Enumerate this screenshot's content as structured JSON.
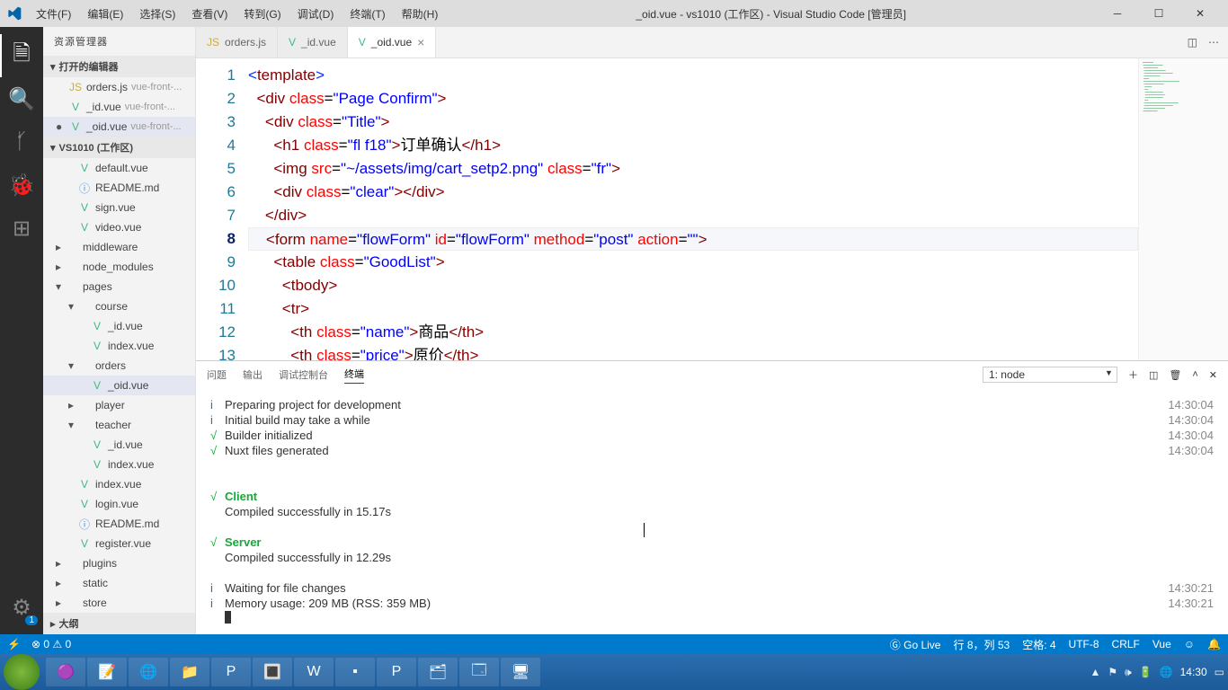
{
  "titlebar": {
    "app_title": "_oid.vue - vs1010 (工作区) - Visual Studio Code [管理员]",
    "menus": [
      "文件(F)",
      "编辑(E)",
      "选择(S)",
      "查看(V)",
      "转到(G)",
      "调试(D)",
      "终端(T)",
      "帮助(H)"
    ]
  },
  "sidebar": {
    "header": "资源管理器",
    "open_editors_label": "打开的编辑器",
    "open_editors": [
      {
        "name": "orders.js",
        "hint": "vue-front-...",
        "kind": "js"
      },
      {
        "name": "_id.vue",
        "hint": "vue-front-...",
        "kind": "vue"
      },
      {
        "name": "_oid.vue",
        "hint": "vue-front-...",
        "kind": "vue",
        "active": true
      }
    ],
    "workspace_label": "VS1010 (工作区)",
    "tree": [
      {
        "d": 1,
        "t": "",
        "name": "default.vue",
        "kind": "vue"
      },
      {
        "d": 1,
        "t": "",
        "name": "README.md",
        "kind": "info"
      },
      {
        "d": 1,
        "t": "",
        "name": "sign.vue",
        "kind": "vue"
      },
      {
        "d": 1,
        "t": "",
        "name": "video.vue",
        "kind": "vue"
      },
      {
        "d": 0,
        "t": "▸",
        "name": "middleware",
        "kind": "folder"
      },
      {
        "d": 0,
        "t": "▸",
        "name": "node_modules",
        "kind": "folder"
      },
      {
        "d": 0,
        "t": "▾",
        "name": "pages",
        "kind": "folder"
      },
      {
        "d": 1,
        "t": "▾",
        "name": "course",
        "kind": "folder"
      },
      {
        "d": 2,
        "t": "",
        "name": "_id.vue",
        "kind": "vue"
      },
      {
        "d": 2,
        "t": "",
        "name": "index.vue",
        "kind": "vue"
      },
      {
        "d": 1,
        "t": "▾",
        "name": "orders",
        "kind": "folder"
      },
      {
        "d": 2,
        "t": "",
        "name": "_oid.vue",
        "kind": "vue",
        "sel": true
      },
      {
        "d": 1,
        "t": "▸",
        "name": "player",
        "kind": "folder"
      },
      {
        "d": 1,
        "t": "▾",
        "name": "teacher",
        "kind": "folder"
      },
      {
        "d": 2,
        "t": "",
        "name": "_id.vue",
        "kind": "vue"
      },
      {
        "d": 2,
        "t": "",
        "name": "index.vue",
        "kind": "vue"
      },
      {
        "d": 1,
        "t": "",
        "name": "index.vue",
        "kind": "vue"
      },
      {
        "d": 1,
        "t": "",
        "name": "login.vue",
        "kind": "vue"
      },
      {
        "d": 1,
        "t": "",
        "name": "README.md",
        "kind": "info"
      },
      {
        "d": 1,
        "t": "",
        "name": "register.vue",
        "kind": "vue"
      },
      {
        "d": 0,
        "t": "▸",
        "name": "plugins",
        "kind": "folder"
      },
      {
        "d": 0,
        "t": "▸",
        "name": "static",
        "kind": "folder"
      },
      {
        "d": 0,
        "t": "▸",
        "name": "store",
        "kind": "folder"
      }
    ],
    "outline_label": "大纲"
  },
  "tabs": [
    {
      "label": "orders.js",
      "kind": "js"
    },
    {
      "label": "_id.vue",
      "kind": "vue"
    },
    {
      "label": "_oid.vue",
      "kind": "vue",
      "active": true
    }
  ],
  "code": {
    "current_line": 8,
    "lines": [
      {
        "n": 1,
        "html": "<span class='tok-brk'>&lt;</span><span class='tok-tag'>template</span><span class='tok-brk'>&gt;</span>"
      },
      {
        "n": 2,
        "html": "  <span class='tok-pun'>&lt;</span><span class='tok-tag'>div</span> <span class='tok-attr'>class</span>=<span class='tok-str'>\"Page Confirm\"</span><span class='tok-pun'>&gt;</span>"
      },
      {
        "n": 3,
        "html": "    <span class='tok-pun'>&lt;</span><span class='tok-tag'>div</span> <span class='tok-attr'>class</span>=<span class='tok-str'>\"Title\"</span><span class='tok-pun'>&gt;</span>"
      },
      {
        "n": 4,
        "html": "      <span class='tok-pun'>&lt;</span><span class='tok-tag'>h1</span> <span class='tok-attr'>class</span>=<span class='tok-str'>\"fl f18\"</span><span class='tok-pun'>&gt;</span><span class='tok-txt'>订单确认</span><span class='tok-pun'>&lt;/</span><span class='tok-tag'>h1</span><span class='tok-pun'>&gt;</span>"
      },
      {
        "n": 5,
        "html": "      <span class='tok-pun'>&lt;</span><span class='tok-tag'>img</span> <span class='tok-attr'>src</span>=<span class='tok-str'>\"~/assets/img/cart_setp2.png\"</span> <span class='tok-attr'>class</span>=<span class='tok-str'>\"fr\"</span><span class='tok-pun'>&gt;</span>"
      },
      {
        "n": 6,
        "html": "      <span class='tok-pun'>&lt;</span><span class='tok-tag'>div</span> <span class='tok-attr'>class</span>=<span class='tok-str'>\"clear\"</span><span class='tok-pun'>&gt;&lt;/</span><span class='tok-tag'>div</span><span class='tok-pun'>&gt;</span>"
      },
      {
        "n": 7,
        "html": "    <span class='tok-pun'>&lt;/</span><span class='tok-tag'>div</span><span class='tok-pun'>&gt;</span>"
      },
      {
        "n": 8,
        "html": "    <span class='tok-pun'>&lt;</span><span class='tok-tag'>form</span> <span class='tok-attr'>name</span>=<span class='tok-str'>\"flowForm\"</span> <span class='tok-attr'>id</span>=<span class='tok-str'>\"flowForm\"</span> <span class='tok-attr'>method</span>=<span class='tok-str'>\"post\"</span> <span class='tok-attr'>action</span>=<span class='tok-str'>\"\"</span><span class='tok-pun'>&gt;</span>"
      },
      {
        "n": 9,
        "html": "      <span class='tok-pun'>&lt;</span><span class='tok-tag'>table</span> <span class='tok-attr'>class</span>=<span class='tok-str'>\"GoodList\"</span><span class='tok-pun'>&gt;</span>"
      },
      {
        "n": 10,
        "html": "        <span class='tok-pun'>&lt;</span><span class='tok-tag'>tbody</span><span class='tok-pun'>&gt;</span>"
      },
      {
        "n": 11,
        "html": "        <span class='tok-pun'>&lt;</span><span class='tok-tag'>tr</span><span class='tok-pun'>&gt;</span>"
      },
      {
        "n": 12,
        "html": "          <span class='tok-pun'>&lt;</span><span class='tok-tag'>th</span> <span class='tok-attr'>class</span>=<span class='tok-str'>\"name\"</span><span class='tok-pun'>&gt;</span><span class='tok-txt'>商品</span><span class='tok-pun'>&lt;/</span><span class='tok-tag'>th</span><span class='tok-pun'>&gt;</span>"
      },
      {
        "n": 13,
        "html": "          <span class='tok-pun'>&lt;</span><span class='tok-tag'>th</span> <span class='tok-attr'>class</span>=<span class='tok-str'>\"price\"</span><span class='tok-pun'>&gt;</span><span class='tok-txt'>原价</span><span class='tok-pun'>&lt;/</span><span class='tok-tag'>th</span><span class='tok-pun'>&gt;</span>"
      }
    ]
  },
  "panel": {
    "tabs": [
      "问题",
      "输出",
      "调试控制台",
      "终端"
    ],
    "active_tab": 3,
    "select": "1: node",
    "lines": [
      {
        "m": "i",
        "t": "Preparing project for development",
        "ts": "14:30:04"
      },
      {
        "m": "i",
        "t": "Initial build may take a while",
        "ts": "14:30:04"
      },
      {
        "m": "ok",
        "t": "Builder initialized",
        "ts": "14:30:04"
      },
      {
        "m": "ok",
        "t": "Nuxt files generated",
        "ts": "14:30:04"
      },
      {
        "blank": true
      },
      {
        "blank": true
      },
      {
        "m": "ok",
        "g": "Client"
      },
      {
        "t": "Compiled successfully in 15.17s"
      },
      {
        "blank": true
      },
      {
        "m": "ok",
        "g": "Server"
      },
      {
        "t": "Compiled successfully in 12.29s"
      },
      {
        "blank": true
      },
      {
        "m": "i",
        "t": "Waiting for file changes",
        "ts": "14:30:21"
      },
      {
        "m": "i",
        "t": "Memory usage: 209 MB (RSS: 359 MB)",
        "ts": "14:30:21"
      }
    ]
  },
  "status": {
    "left_err": "⊗ 0 ⚠ 0",
    "golive": "Ⓖ Go Live",
    "pos": "行 8，列 53",
    "spaces": "空格: 4",
    "enc": "UTF-8",
    "eol": "CRLF",
    "lang": "Vue",
    "smile": "☺",
    "bell": "🔔"
  },
  "taskbar": {
    "clock": "14:30"
  }
}
